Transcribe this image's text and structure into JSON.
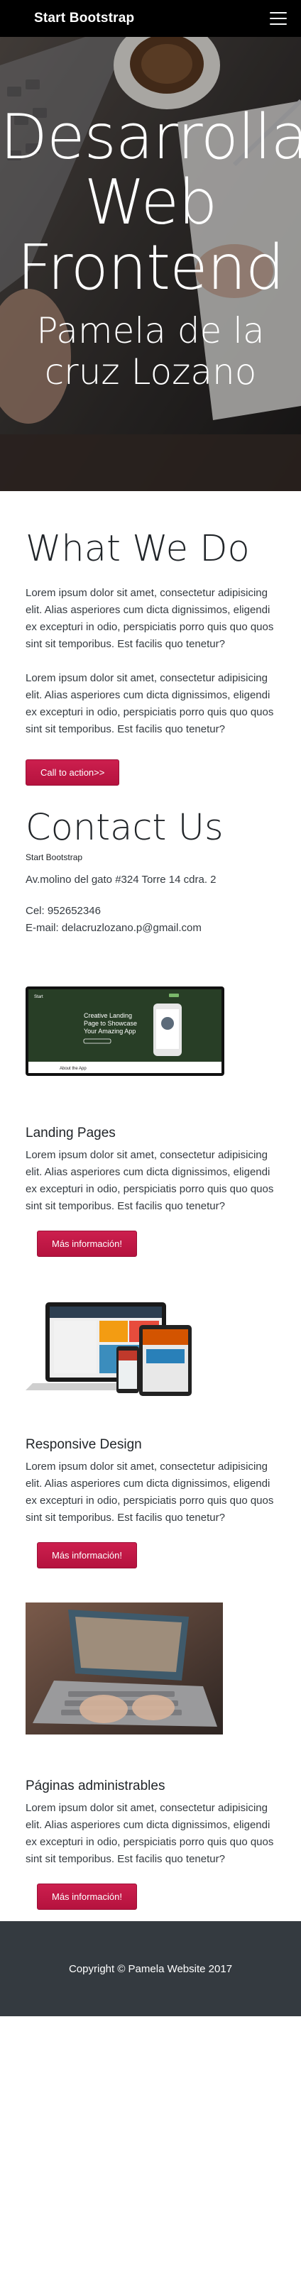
{
  "navbar": {
    "brand": "Start Bootstrap",
    "toggler_icon": "hamburger-icon"
  },
  "hero": {
    "title_lines": [
      "Desarrolla",
      "Web",
      "Frontend"
    ],
    "subtitle_lines": [
      "Pamela de la",
      "cruz Lozano"
    ]
  },
  "what_we_do": {
    "heading": "What We Do",
    "paragraph_1": "Lorem ipsum dolor sit amet, consectetur adipisicing elit. Alias asperiores cum dicta dignissimos, eligendi ex excepturi in odio, perspiciatis porro quis quo quos sint sit temporibus. Est facilis quo tenetur?",
    "paragraph_2": "Lorem ipsum dolor sit amet, consectetur adipisicing elit. Alias asperiores cum dicta dignissimos, eligendi ex excepturi in odio, perspiciatis porro quis quo quos sint sit temporibus. Est facilis quo tenetur?",
    "button": "Call to action>>"
  },
  "contact": {
    "heading": "Contact Us",
    "company": "Start Bootstrap",
    "address": "Av.molino del gato #324 Torre 14 cdra. 2",
    "phone": "Cel: 952652346",
    "email": "E-mail: delacruzlozano.p@gmail.com"
  },
  "cards": [
    {
      "title": "Landing Pages",
      "text": "Lorem ipsum dolor sit amet, consectetur adipisicing elit. Alias asperiores cum dicta dignissimos, eligendi ex excepturi in odio, perspiciatis porro quis quo quos sint sit temporibus. Est facilis quo tenetur?",
      "button": "Más información!",
      "mock": {
        "brand": "Start",
        "headline_1": "Creative Landing",
        "headline_2": "Page to Showcase",
        "headline_3": "Your Amazing App",
        "footer_label": "About the App"
      }
    },
    {
      "title": "Responsive Design",
      "text": "Lorem ipsum dolor sit amet, consectetur adipisicing elit. Alias asperiores cum dicta dignissimos, eligendi ex excepturi in odio, perspiciatis porro quis quo quos sint sit temporibus. Est facilis quo tenetur?",
      "button": "Más información!"
    },
    {
      "title": "Páginas administrables",
      "text": "Lorem ipsum dolor sit amet, consectetur adipisicing elit. Alias asperiores cum dicta dignissimos, eligendi ex excepturi in odio, perspiciatis porro quis quo quos sint sit temporibus. Est facilis quo tenetur?",
      "button": "Más información!"
    }
  ],
  "footer": {
    "copyright": "Copyright © Pamela Website 2017"
  },
  "colors": {
    "navbar": "#000000",
    "accent_button": "#b5123e",
    "footer": "#343a40",
    "text": "#212529"
  }
}
